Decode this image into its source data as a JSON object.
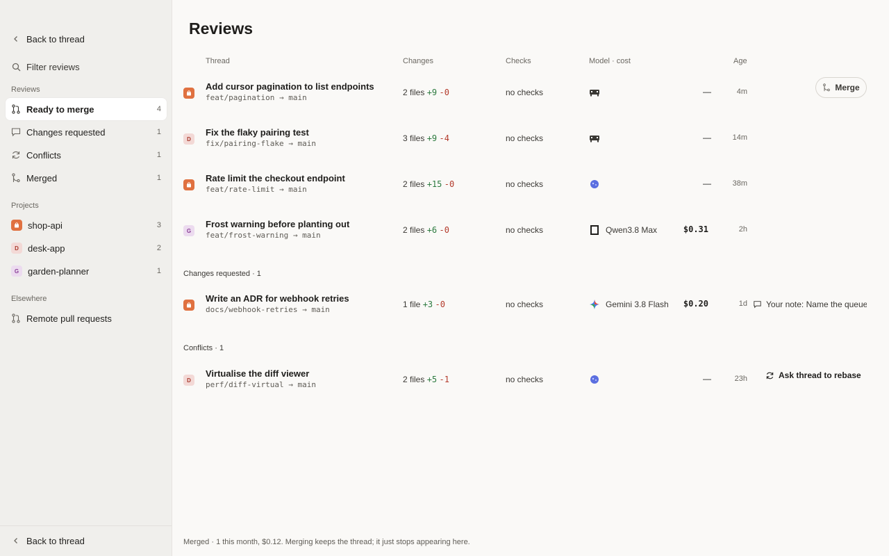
{
  "sidebar": {
    "back_label": "Back to thread",
    "filter_label": "Filter reviews",
    "reviews_heading": "Reviews",
    "review_items": [
      {
        "label": "Ready to merge",
        "count": "4"
      },
      {
        "label": "Changes requested",
        "count": "1"
      },
      {
        "label": "Conflicts",
        "count": "1"
      },
      {
        "label": "Merged",
        "count": "1"
      }
    ],
    "projects_heading": "Projects",
    "projects": [
      {
        "label": "shop-api",
        "count": "3",
        "icon": "shopping-bag-icon"
      },
      {
        "label": "desk-app",
        "count": "2",
        "letter": "D"
      },
      {
        "label": "garden-planner",
        "count": "1",
        "letter": "G"
      }
    ],
    "elsewhere_heading": "Elsewhere",
    "elsewhere_items": [
      {
        "label": "Remote pull requests"
      }
    ],
    "bottom_back_label": "Back to thread"
  },
  "main": {
    "title": "Reviews",
    "columns": {
      "thread": "Thread",
      "changes": "Changes",
      "checks": "Checks",
      "model_cost": "Model · cost",
      "age": "Age"
    },
    "ready_rows": [
      {
        "title": "Add cursor pagination to list endpoints",
        "branch": "feat/pagination → main",
        "files": "2 files",
        "add": "+9",
        "del": "-0",
        "checks": "no checks",
        "model": "",
        "cost": "—",
        "age": "4m",
        "action": "Merge"
      },
      {
        "title": "Fix the flaky pairing test",
        "branch": "fix/pairing-flake → main",
        "files": "3 files",
        "add": "+9",
        "del": "-4",
        "checks": "no checks",
        "model": "",
        "cost": "—",
        "age": "14m"
      },
      {
        "title": "Rate limit the checkout endpoint",
        "branch": "feat/rate-limit → main",
        "files": "2 files",
        "add": "+15",
        "del": "-0",
        "checks": "no checks",
        "model": "",
        "cost": "—",
        "age": "38m"
      },
      {
        "title": "Frost warning before planting out",
        "branch": "feat/frost-warning → main",
        "files": "2 files",
        "add": "+6",
        "del": "-0",
        "checks": "no checks",
        "model": "Qwen3.8 Max",
        "cost": "$0.31",
        "age": "2h"
      }
    ],
    "changes_requested_label": "Changes requested · 1",
    "changes_rows": [
      {
        "title": "Write an ADR for webhook retries",
        "branch": "docs/webhook-retries → main",
        "files": "1 file",
        "add": "+3",
        "del": "-0",
        "checks": "no checks",
        "model": "Gemini 3.8 Flash",
        "cost": "$0.20",
        "age": "1d",
        "note": "Your note: Name the queue"
      }
    ],
    "conflicts_label": "Conflicts · 1",
    "conflict_rows": [
      {
        "title": "Virtualise the diff viewer",
        "branch": "perf/diff-virtual → main",
        "files": "2 files",
        "add": "+5",
        "del": "-1",
        "checks": "no checks",
        "model": "",
        "cost": "—",
        "age": "23h",
        "action": "Ask thread to rebase"
      }
    ],
    "footer": "Merged · 1 this month, $0.12. Merging keeps the thread; it just stops appearing here."
  },
  "colors": {
    "accent_orange": "#e07140",
    "add_green": "#2c7a3f",
    "del_red": "#b33a2b"
  }
}
